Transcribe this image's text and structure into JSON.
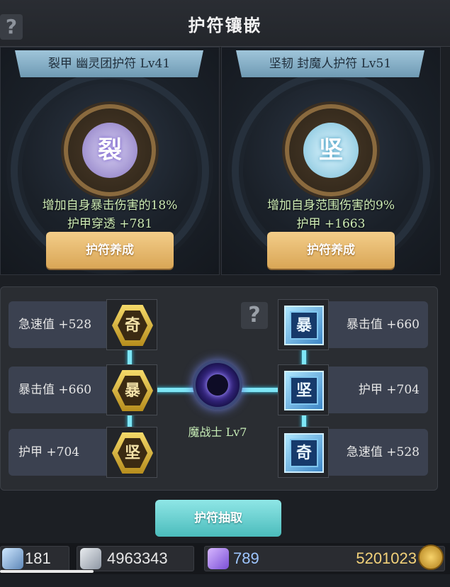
{
  "header": {
    "title": "护符镶嵌",
    "help_icon": "?"
  },
  "cards": [
    {
      "banner": "裂甲 幽灵团护符 Lv41",
      "glyph": "裂",
      "effect_line1": "增加自身暴击伤害的18%",
      "effect_line2": "护甲穿透 +781",
      "button": "护符养成",
      "accent": "#8978c2"
    },
    {
      "banner": "坚韧 封魔人护符 Lv51",
      "glyph": "坚",
      "effect_line1": "增加自身范围伤害的9%",
      "effect_line2": "护甲 +1663",
      "button": "护符养成",
      "accent": "#7bbfd9"
    }
  ],
  "left_stats": [
    {
      "label": "急速值 +528",
      "rune": "奇"
    },
    {
      "label": "暴击值 +660",
      "rune": "暴"
    },
    {
      "label": "护甲 +704",
      "rune": "坚"
    }
  ],
  "right_stats": [
    {
      "label": "暴击值 +660",
      "rune": "暴"
    },
    {
      "label": "护甲 +704",
      "rune": "坚"
    },
    {
      "label": "急速值 +528",
      "rune": "奇"
    }
  ],
  "center": {
    "character": "魔战士 Lv7",
    "help_icon": "?"
  },
  "draw_button": "护符抽取",
  "currencies": [
    {
      "icon": "sword-icon",
      "value": "181"
    },
    {
      "icon": "armor-icon",
      "value": "4963343"
    },
    {
      "icon": "crystal-icon",
      "value": "789"
    },
    {
      "icon": "gold-coin-icon",
      "value": "5201023"
    }
  ]
}
